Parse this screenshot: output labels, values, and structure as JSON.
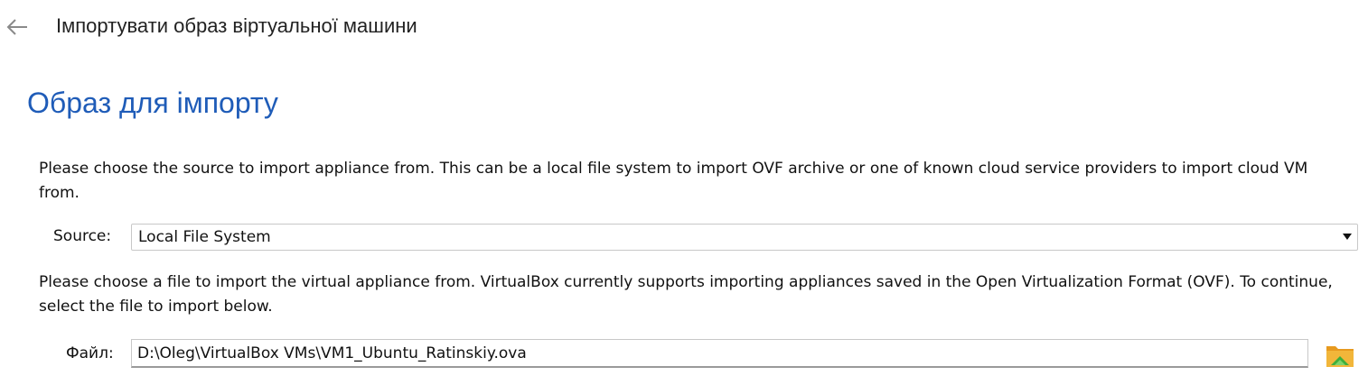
{
  "header": {
    "title": "Імпортувати образ віртуальної машини",
    "back_icon": "arrow-left-icon"
  },
  "page": {
    "title": "Образ для імпорту"
  },
  "source_section": {
    "description": "Please choose the source to import appliance from. This can be a local file system to import OVF archive or one of known cloud service providers to import cloud VM from.",
    "label": "Source:",
    "selected_value": "Local File System",
    "dropdown_icon": "chevron-down-icon"
  },
  "file_section": {
    "description": "Please choose a file to import the virtual appliance from. VirtualBox currently supports importing appliances saved in the Open Virtualization Format (OVF). To continue, select the file to import below.",
    "label": "Файл:",
    "path_value": "D:\\Oleg\\VirtualBox VMs\\VM1_Ubuntu_Ratinskiy.ova",
    "browse_icon": "folder-browse-icon"
  },
  "colors": {
    "accent": "#1f5cb8",
    "folder_yellow": "#f2b63a",
    "folder_green": "#3fae3a"
  }
}
